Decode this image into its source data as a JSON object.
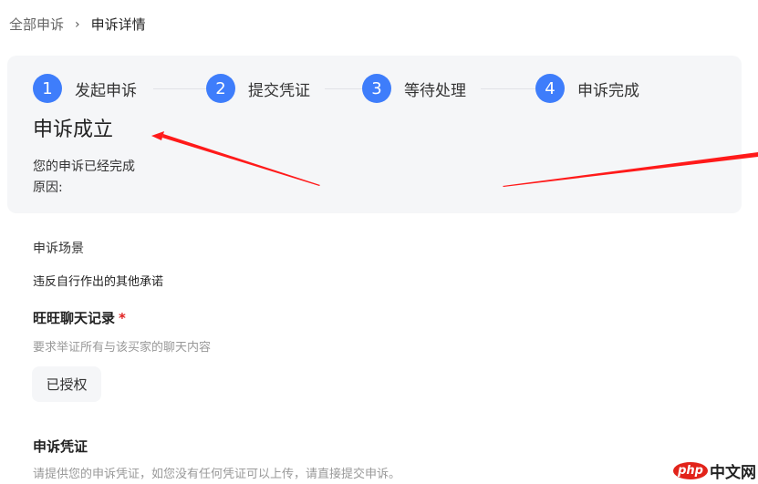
{
  "breadcrumb": {
    "parent": "全部申诉",
    "separator": "›",
    "current": "申诉详情"
  },
  "steps": [
    {
      "num": "1",
      "label": "发起申诉"
    },
    {
      "num": "2",
      "label": "提交凭证"
    },
    {
      "num": "3",
      "label": "等待处理"
    },
    {
      "num": "4",
      "label": "申诉完成"
    }
  ],
  "status": {
    "title": "申诉成立",
    "message": "您的申诉已经完成",
    "reason_label": "原因:"
  },
  "scene": {
    "label": "申诉场景",
    "value": "违反自行作出的其他承诺"
  },
  "chat": {
    "title": "旺旺聊天记录",
    "required": "*",
    "hint": "要求举证所有与该买家的聊天内容",
    "button": "已授权"
  },
  "evidence": {
    "title": "申诉凭证",
    "hint": "请提供您的申诉凭证，如您没有任何凭证可以上传，请直接提交申诉。"
  },
  "watermark": {
    "logo": "php",
    "text": "中文网"
  },
  "colors": {
    "accent": "#3e7dfb",
    "annotation": "#ff1a1a"
  }
}
